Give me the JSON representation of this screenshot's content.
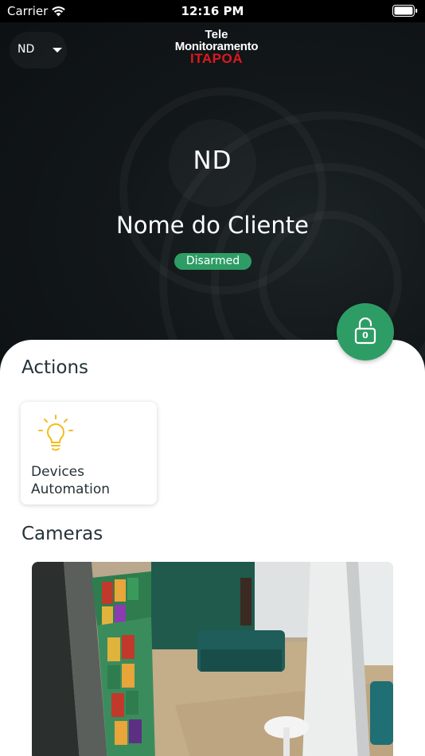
{
  "status_bar": {
    "carrier": "Carrier",
    "time": "12:16 PM"
  },
  "header": {
    "account_initials": "ND",
    "logo": {
      "line1": "Tele",
      "line2": "Monitoramento",
      "line3": "ITAPOÁ",
      "line3_color": "#e0191d"
    },
    "avatar_initials": "ND",
    "client_name": "Nome do Cliente",
    "status": "Disarmed",
    "status_color": "#2e9d65"
  },
  "fab": {
    "icon": "unlocked-padlock-icon",
    "count": "0",
    "color": "#2e9d65"
  },
  "actions": {
    "title": "Actions",
    "items": [
      {
        "icon": "lightbulb-icon",
        "label": "Devices Automation",
        "icon_color": "#f2bd1d"
      }
    ]
  },
  "cameras": {
    "title": "Cameras"
  }
}
